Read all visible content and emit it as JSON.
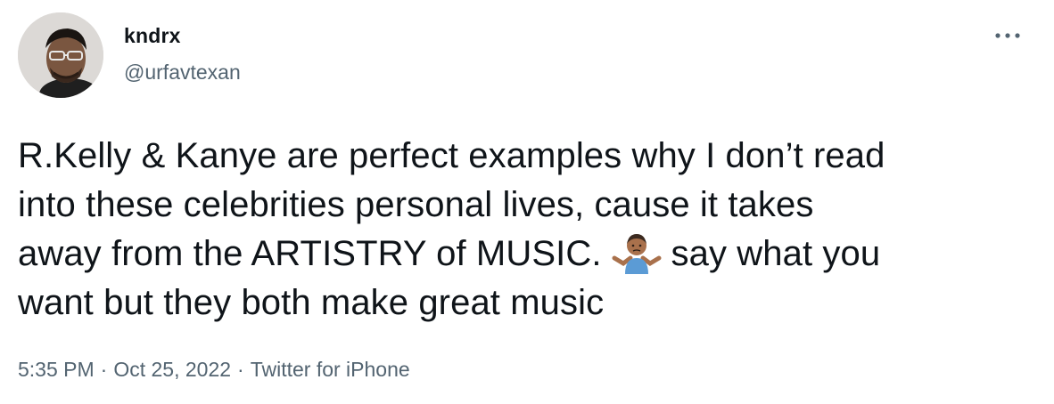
{
  "author": {
    "display_name": "kndrx",
    "handle": "@urfavtexan",
    "avatar_icon": "profile-photo"
  },
  "menu": {
    "icon": "more-horizontal-icon",
    "glyph": "···"
  },
  "tweet": {
    "lines": [
      "R.Kelly & Kanye are perfect examples why I don’t read",
      "into these celebrities personal lives, cause it takes",
      "away from the ARTISTRY of MUSIC.",
      "say what you",
      "want but they both make great music"
    ],
    "emoji": "man-shrugging-emoji"
  },
  "meta": {
    "time": "5:35 PM",
    "separator": "·",
    "date": "Oct 25, 2022",
    "source": "Twitter for iPhone"
  },
  "colors": {
    "text_primary": "#0f1419",
    "text_secondary": "#536471",
    "background": "#ffffff"
  }
}
